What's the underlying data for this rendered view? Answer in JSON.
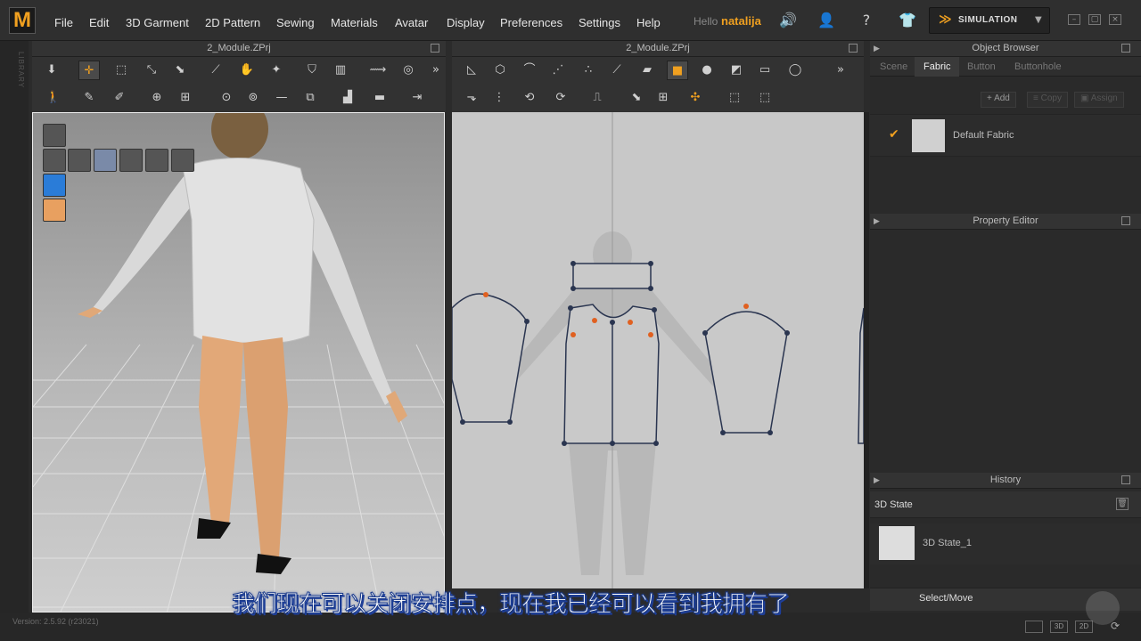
{
  "app": {
    "logo_letter": "M",
    "menu": [
      "File",
      "Edit",
      "3D Garment",
      "2D Pattern",
      "Sewing",
      "Materials",
      "Avatar",
      "Display",
      "Preferences",
      "Settings",
      "Help"
    ],
    "greeting": "Hello",
    "username": "natalija",
    "simulation_label": "SIMULATION",
    "library_label": "LIBRARY",
    "accent_color": "#f0a020"
  },
  "viewport3d": {
    "title": "2_Module.ZPrj"
  },
  "viewport2d": {
    "title": "2_Module.ZPrj"
  },
  "object_browser": {
    "title": "Object Browser",
    "tabs": [
      "Scene",
      "Fabric",
      "Button",
      "Buttonhole"
    ],
    "active_tab": "Fabric",
    "buttons": {
      "add": "Add",
      "copy": "Copy",
      "assign": "Assign"
    },
    "fabric_item": "Default Fabric"
  },
  "property_editor": {
    "title": "Property Editor"
  },
  "history": {
    "title": "History",
    "state_header": "3D State",
    "state_item": "3D State_1"
  },
  "status": {
    "mode": "Select/Move",
    "version": "Version: 2.5.92   (r23021)",
    "view_modes": [
      "3D",
      "2D"
    ]
  },
  "subtitle": "我们现在可以关闭安排点，现在我已经可以看到我拥有了"
}
